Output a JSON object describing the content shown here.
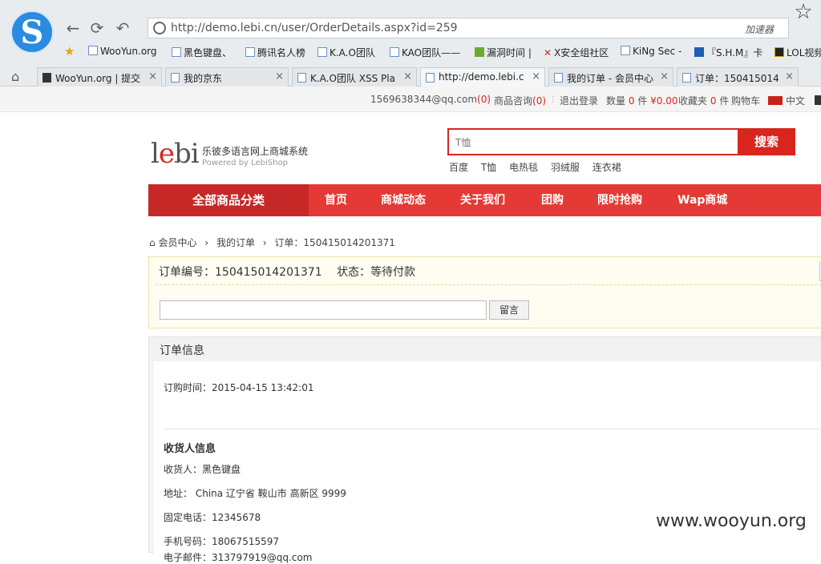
{
  "browser": {
    "url": "http://demo.lebi.cn/user/OrderDetails.aspx?id=259",
    "accelerator": "加速器",
    "bookmarks": [
      "WooYun.org",
      "黑色键盘、",
      "腾讯名人榜",
      "K.A.O团队",
      "KAO团队——",
      "漏洞时间 |",
      "X安全组社区",
      "KiNg Sec -",
      "『S.H.M』卡",
      "LOL视频"
    ],
    "tabs": [
      {
        "title": "WooYun.org | 提交"
      },
      {
        "title": "我的京东"
      },
      {
        "title": "K.A.O团队 XSS Pla"
      },
      {
        "title": "http://demo.lebi.c"
      },
      {
        "title": "我的订单 - 会员中心"
      },
      {
        "title": "订单：150415014"
      }
    ]
  },
  "topbar": {
    "email": "1569638344@qq.com",
    "email_count": "(0)",
    "consult": "商品咨询",
    "consult_count": "(0)",
    "logout": "退出登录",
    "qty_label": "数量",
    "qty": "0",
    "unit": "件",
    "amount": "¥0.00",
    "fav_label": "收藏夹",
    "fav": "0",
    "fav_unit": "件",
    "cart": "购物车",
    "lang": "中文"
  },
  "site": {
    "logo_text": "lebi",
    "name": "乐彼多语言网上商城系统",
    "powered": "Powered by LebiShop",
    "search_placeholder": "T恤",
    "search_button": "搜索",
    "hot_words": [
      "百度",
      "T恤",
      "电热毯",
      "羽绒服",
      "连衣裙"
    ]
  },
  "menu": {
    "all_categories": "全部商品分类",
    "items": [
      "首页",
      "商城动态",
      "关于我们",
      "团购",
      "限时抢购",
      "Wap商城"
    ]
  },
  "breadcrumb": [
    "会员中心",
    "我的订单",
    "订单：150415014201371"
  ],
  "order": {
    "number_label": "订单编号：",
    "number": "150415014201371",
    "status_label": "状态：",
    "status": "等待付款",
    "message_button": "留言"
  },
  "info": {
    "title": "订单信息",
    "order_time_label": "订购时间：",
    "order_time": "2015-04-15 13:42:01",
    "receiver_title": "收货人信息",
    "receiver_label": "收货人：",
    "receiver": "黑色键盘",
    "address_label": "地址：",
    "address": "China 辽宁省 鞍山市 高新区 9999",
    "phone_label": "固定电话：",
    "phone": "12345678",
    "mobile_label": "手机号码：",
    "mobile": "18067515597",
    "email_label": "电子邮件：",
    "email": "313797919@qq.com"
  },
  "watermark": "www.wooyun.org"
}
